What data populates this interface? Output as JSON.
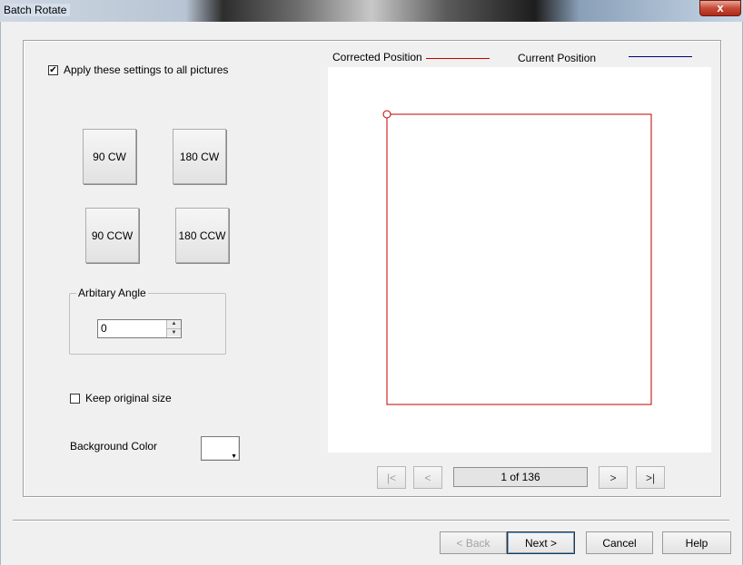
{
  "window": {
    "title": "Batch Rotate",
    "close_glyph": "x"
  },
  "options": {
    "apply_all_label": "Apply these settings to all pictures",
    "apply_all_checked": true,
    "keep_size_label": "Keep original size",
    "keep_size_checked": false
  },
  "rotate_buttons": {
    "cw90": "90 CW",
    "cw180": "180 CW",
    "ccw90": "90 CCW",
    "ccw180": "180 CCW"
  },
  "angle": {
    "group_label": "Arbitary Angle",
    "value": "0"
  },
  "background": {
    "label": "Background Color",
    "color": "#ffffff"
  },
  "preview": {
    "corrected_label": "Corrected Position",
    "current_label": "Current Position",
    "corrected_color": "#c00000",
    "current_color": "#000080"
  },
  "navigation": {
    "first_label": "|<",
    "prev_label": "<",
    "page_text": "1 of 136",
    "next_label": ">",
    "last_label": ">|"
  },
  "footer": {
    "back_label": "< Back",
    "next_label": "Next >",
    "cancel_label": "Cancel",
    "help_label": "Help"
  }
}
